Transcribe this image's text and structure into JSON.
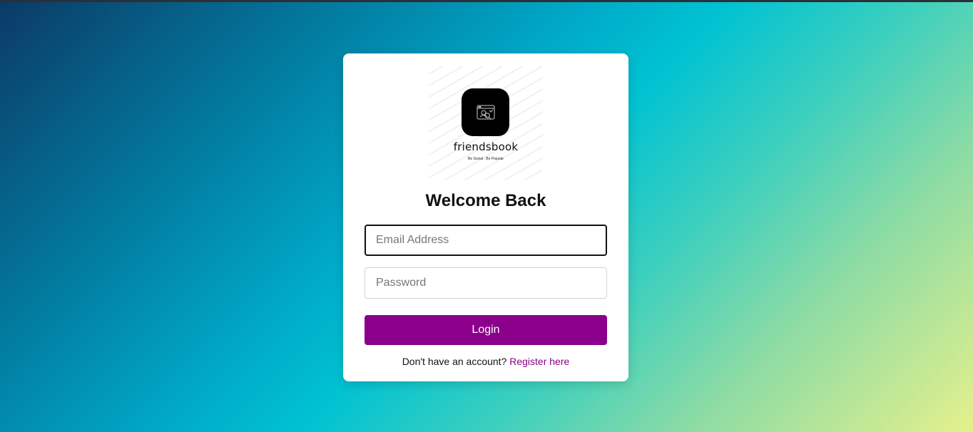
{
  "brand": {
    "name": "friendsbook",
    "tagline": "Be Social . Be Popular",
    "logo_icon": "browser-user-icon"
  },
  "login": {
    "title": "Welcome Back",
    "email_placeholder": "Email Address",
    "email_value": "",
    "password_placeholder": "Password",
    "password_value": "",
    "button_label": "Login",
    "register_prompt": "Don't have an account?",
    "register_link": "Register here"
  },
  "colors": {
    "accent": "#8b008b",
    "background_start": "#0b3a66",
    "background_end": "#e6f08c"
  }
}
